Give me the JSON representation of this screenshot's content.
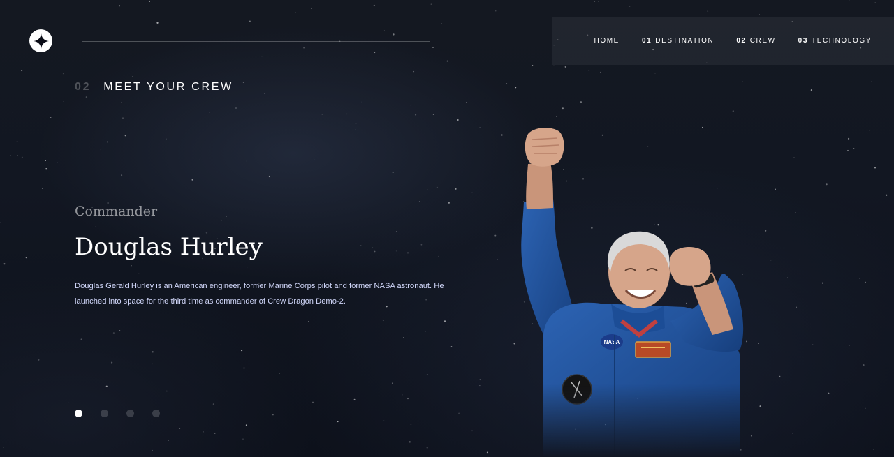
{
  "nav": {
    "items": [
      {
        "num": "",
        "label": "HOME"
      },
      {
        "num": "01",
        "label": "DESTINATION"
      },
      {
        "num": "02",
        "label": "CREW"
      },
      {
        "num": "03",
        "label": "TECHNOLOGY"
      }
    ]
  },
  "section": {
    "num": "02",
    "title": "MEET YOUR CREW"
  },
  "crew": {
    "role": "Commander",
    "name": "Douglas Hurley",
    "bio": "Douglas Gerald Hurley is an American engineer, former Marine Corps pilot and former NASA astronaut. He launched into space for the third time as commander of Crew Dragon Demo-2.",
    "active_index": 0,
    "count": 4
  },
  "icons": {
    "logo": "star-logo-icon"
  },
  "colors": {
    "background": "#0b0d17",
    "text": "#ffffff",
    "body_text": "#d0d6f9",
    "suit": "#1f4f97"
  }
}
